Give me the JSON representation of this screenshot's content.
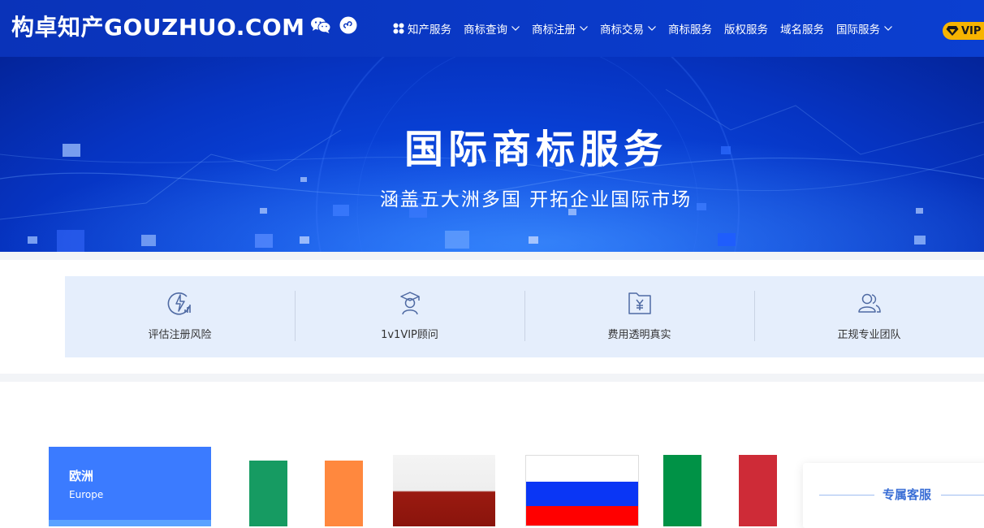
{
  "header": {
    "logo_cn": "构卓知产",
    "logo_en": "GOUZHUO.COM",
    "icons": [
      "wechat-icon",
      "mini-program-icon"
    ],
    "nav": [
      {
        "label": "知产服务",
        "icon": "grid-icon",
        "dropdown": false
      },
      {
        "label": "商标查询",
        "dropdown": true
      },
      {
        "label": "商标注册",
        "dropdown": true
      },
      {
        "label": "商标交易",
        "dropdown": true
      },
      {
        "label": "商标服务",
        "dropdown": false
      },
      {
        "label": "版权服务",
        "dropdown": false
      },
      {
        "label": "域名服务",
        "dropdown": false
      },
      {
        "label": "国际服务",
        "dropdown": true
      }
    ],
    "vip_label": "VIP"
  },
  "banner": {
    "title": "国际商标服务",
    "subtitle": "涵盖五大洲多国 开拓企业国际市场"
  },
  "features": [
    {
      "icon": "risk-assessment-icon",
      "label": "评估注册风险"
    },
    {
      "icon": "consultant-icon",
      "label": "1v1VIP顾问"
    },
    {
      "icon": "fee-document-icon",
      "label": "费用透明真实"
    },
    {
      "icon": "team-icon",
      "label": "正规专业团队"
    }
  ],
  "region": {
    "name": "欧洲",
    "name_en": "Europe"
  },
  "flags": [
    "ireland-flag",
    "poland-flag",
    "russia-flag",
    "italy-flag"
  ],
  "colors": {
    "header_bg": "#0a33b9",
    "accent": "#3b7bff",
    "feature_bg": "#e5eefc",
    "vip": "#f7b400",
    "italy_green": "#009246",
    "italy_white": "#ffffff",
    "italy_red": "#ce2b37"
  },
  "service_panel": {
    "title": "专属客服"
  }
}
